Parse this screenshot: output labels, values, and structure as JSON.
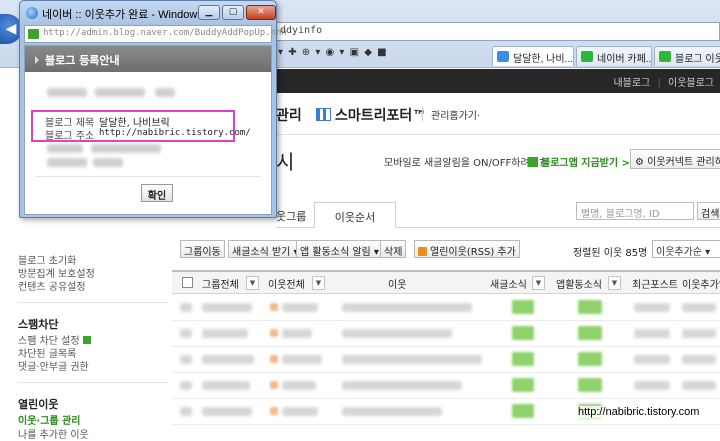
{
  "browser": {
    "address_rest": "ddyinfo",
    "tabs": [
      {
        "label": "달달한, 나비...",
        "fav_color": "#3c8ee0"
      },
      {
        "label": "네이버 카페...",
        "fav_color": "#2fb73a"
      },
      {
        "label": "블로그 이웃...",
        "fav_color": "#2fb73a"
      }
    ]
  },
  "site": {
    "top_links": [
      "내블로그",
      "이웃블로그"
    ],
    "nav_fragment": "관리",
    "smart_poster": "스마트리포터™",
    "goto_manage": "관리홈가기·",
    "page_title_fragment": "시",
    "promo_text": "모바일로 새글알림을 ON/OFF하려면?",
    "promo_link": "블로그앱 지금받기 >",
    "neighbor_manage_button": "이웃커넥트 관리하기",
    "tab_group": "웃그룹",
    "tab_order": "이웃순서",
    "search_placeholder": "별명, 블로그명, ID",
    "search_button": "검색",
    "action_buttons": [
      "그룹이동",
      "새글소식 받기 ▾",
      "앱 활동소식 알림 ▾",
      "삭제",
      "열린이웃(RSS) 추가"
    ],
    "sort_label": "정렬된 이웃 85명",
    "sort_select": "이웃추가순 ▾",
    "table_headers": [
      "그룹전체",
      "이웃전체",
      "이웃",
      "새글소식",
      "앱활동소식",
      "최근포스트",
      "이웃추가일"
    ]
  },
  "left_nav": {
    "items_top": [
      "블로그 초기화",
      "방문집계 보호설정",
      "컨텐츠 공유설정"
    ],
    "spam_head": "스팸차단",
    "spam_items": [
      "스팸 차단 설정",
      "차단된 글목록",
      "댓글·안부글 권한"
    ],
    "neighbor_head": "열린이웃",
    "neighbor_items": [
      "이웃·그룹 관리",
      "나를 추가한 이웃"
    ]
  },
  "popup": {
    "title": "네이버 :: 이웃추가 완료 - Windows ...",
    "url": "http://admin.blog.naver.com/BuddyAddPopUp.nhn",
    "header": "블로그 등록안내",
    "blog_title_label": "블로그 제목",
    "blog_title_value": "달달한, 나비브릭",
    "blog_address_label": "블로그 주소",
    "blog_address_value": "http://nabibric.tistory.com/",
    "confirm": "확인"
  },
  "watermark": "http://nabibric.tistory.com"
}
